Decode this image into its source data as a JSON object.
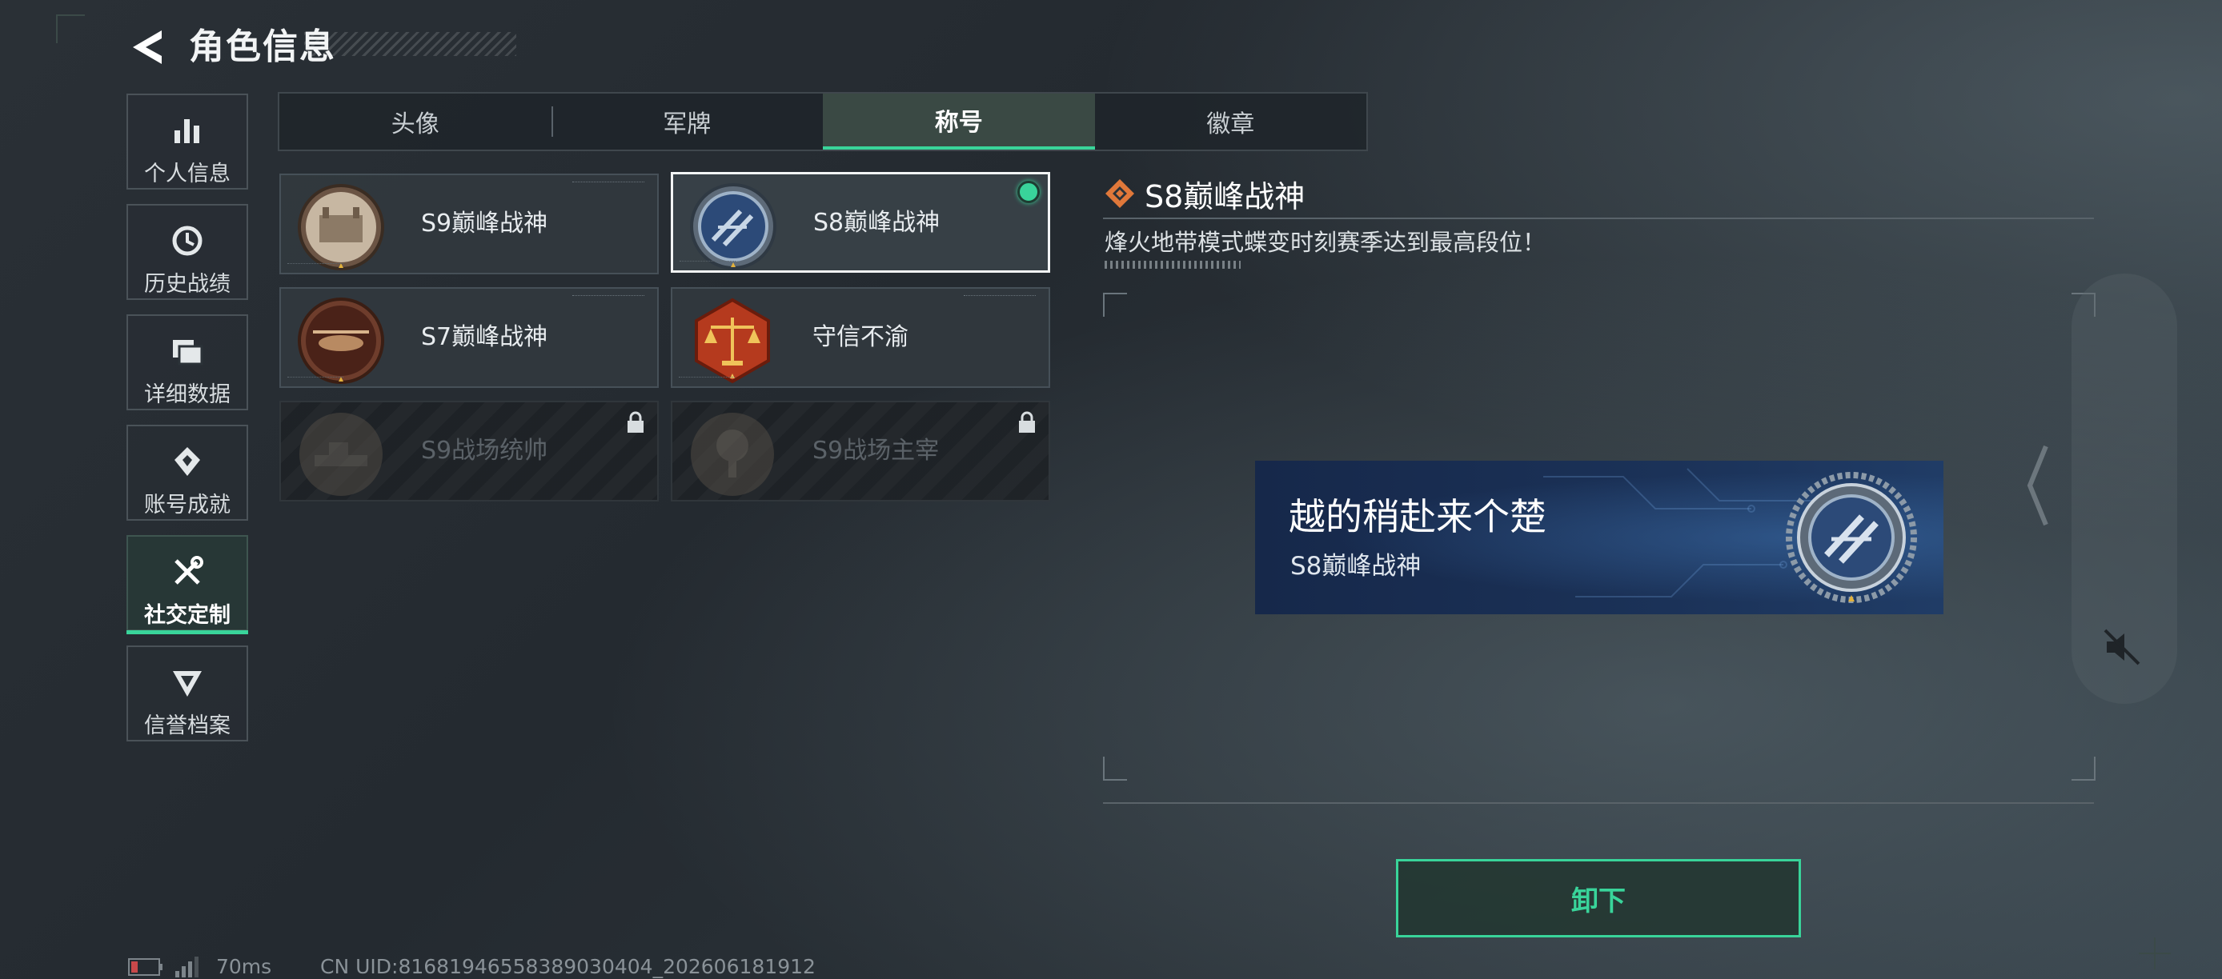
{
  "header": {
    "title": "角色信息",
    "back_icon": "back-arrow-icon"
  },
  "sidebar": {
    "items": [
      {
        "label": "个人信息",
        "icon": "bar-chart-icon",
        "active": false
      },
      {
        "label": "历史战绩",
        "icon": "history-clock-icon",
        "active": false
      },
      {
        "label": "详细数据",
        "icon": "folder-icon",
        "active": false
      },
      {
        "label": "账号成就",
        "icon": "achievement-icon",
        "active": false
      },
      {
        "label": "社交定制",
        "icon": "tools-icon",
        "active": true
      },
      {
        "label": "信誉档案",
        "icon": "reputation-icon",
        "active": false
      }
    ]
  },
  "tabs": [
    {
      "label": "头像",
      "active": false
    },
    {
      "label": "军牌",
      "active": false
    },
    {
      "label": "称号",
      "active": true
    },
    {
      "label": "徽章",
      "active": false
    }
  ],
  "titles": [
    {
      "name": "S9巅峰战神",
      "locked": false,
      "selected": false,
      "equipped": false,
      "emblem": "fortress-emblem-icon"
    },
    {
      "name": "S8巅峰战神",
      "locked": false,
      "selected": true,
      "equipped": true,
      "emblem": "blue-slash-emblem-icon"
    },
    {
      "name": "S7巅峰战神",
      "locked": false,
      "selected": false,
      "equipped": false,
      "emblem": "helicopter-emblem-icon"
    },
    {
      "name": "守信不渝",
      "locked": false,
      "selected": false,
      "equipped": false,
      "emblem": "scales-emblem-icon"
    },
    {
      "name": "S9战场统帅",
      "locked": true,
      "selected": false,
      "equipped": false,
      "emblem": "battleship-emblem-icon"
    },
    {
      "name": "S9战场主宰",
      "locked": true,
      "selected": false,
      "equipped": false,
      "emblem": "explosion-emblem-icon"
    }
  ],
  "detail": {
    "title": "S8巅峰战神",
    "description": "烽火地带模式蝶变时刻赛季达到最高段位！",
    "preview": {
      "player_name": "越的稍赴来个楚",
      "title": "S8巅峰战神"
    },
    "unload_label": "卸下"
  },
  "footer": {
    "ping": "70ms",
    "uid": "CN UID:81681946558389030404_202606181912"
  },
  "colors": {
    "accent": "#39d49a",
    "background": "#262c32",
    "banner": "#1b3258"
  }
}
